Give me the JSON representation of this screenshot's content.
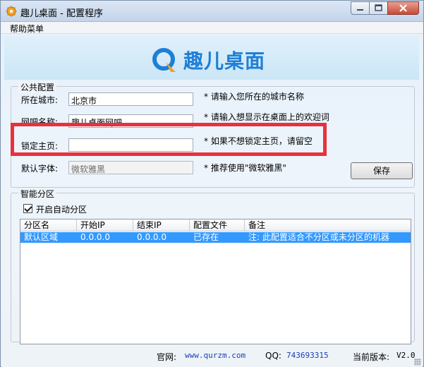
{
  "window": {
    "title": "趣儿桌面 - 配置程序"
  },
  "menu": {
    "help": "帮助菜单"
  },
  "banner": {
    "logo_text": "趣儿桌面",
    "brand_color": "#1e7fd6"
  },
  "public_config": {
    "legend": "公共配置",
    "city": {
      "label": "所在城市:",
      "value": "北京市",
      "hint": "* 请输入您所在的城市名称"
    },
    "cafe_name": {
      "label": "网吧名称:",
      "value": "趣儿桌面网吧",
      "hint": "* 请输入想显示在桌面上的欢迎词"
    },
    "homepage": {
      "label": "锁定主页:",
      "value": "",
      "hint": "* 如果不想锁定主页，请留空"
    },
    "font": {
      "label": "默认字体:",
      "value": "微软雅黑",
      "hint": "* 推荐使用\"微软雅黑\""
    },
    "save_label": "保存"
  },
  "smart_partition": {
    "legend": "智能分区",
    "auto_partition_label": "开启自动分区",
    "auto_partition_checked": true,
    "columns": [
      "分区名",
      "开始IP",
      "结束IP",
      "配置文件",
      "备注"
    ],
    "rows": [
      {
        "name": "默认区域",
        "start_ip": "0.0.0.0",
        "end_ip": "0.0.0.0",
        "config_file": "已存在",
        "note": "注: 此配置适合不分区或未分区的机器",
        "selected": true
      }
    ]
  },
  "status": {
    "website_label": "官网:",
    "website": "www.qurzm.com",
    "qq_label": "QQ:",
    "qq": "743693315",
    "version_label": "当前版本:",
    "version": "V2.0"
  }
}
